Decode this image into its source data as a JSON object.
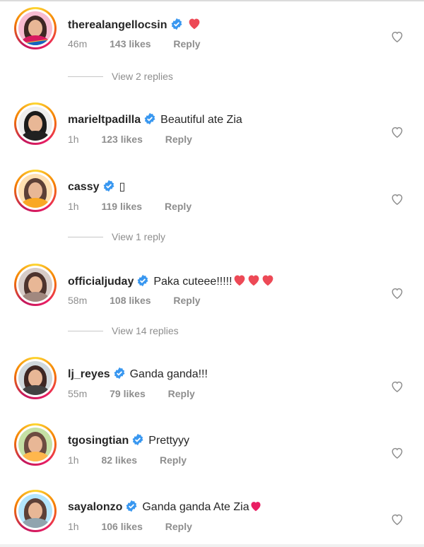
{
  "comments": [
    {
      "username": "therealangellocsin",
      "text": "",
      "emoji": "red-heart",
      "time": "46m",
      "likes": "143 likes",
      "reply": "Reply",
      "avatar_hair": "#3e2723",
      "avatar_body": "#d81b60",
      "has_logo": true
    },
    {
      "username": "marieltpadilla",
      "text": "Beautiful ate Zia",
      "emoji": "",
      "time": "1h",
      "likes": "123 likes",
      "reply": "Reply",
      "avatar_hair": "#1b1b1b",
      "avatar_body": "#212121"
    },
    {
      "username": "cassy",
      "text": "▯",
      "emoji": "",
      "time": "1h",
      "likes": "119 likes",
      "reply": "Reply",
      "avatar_hair": "#5d4037",
      "avatar_body": "#f9a825"
    },
    {
      "username": "officialjuday",
      "text": "Paka cuteee!!!!!",
      "emoji": "red-heart-x3",
      "time": "58m",
      "likes": "108 likes",
      "reply": "Reply",
      "avatar_hair": "#4e342e",
      "avatar_body": "#a1887f"
    },
    {
      "username": "lj_reyes",
      "text": "Ganda ganda!!!",
      "emoji": "",
      "time": "55m",
      "likes": "79 likes",
      "reply": "Reply",
      "avatar_hair": "#3e2723",
      "avatar_body": "#424242"
    },
    {
      "username": "tgosingtian",
      "text": "Prettyyy",
      "emoji": "",
      "time": "1h",
      "likes": "82 likes",
      "reply": "Reply",
      "avatar_hair": "#6d4c41",
      "avatar_body": "#ffb74d"
    },
    {
      "username": "sayalonzo",
      "text": "Ganda ganda Ate Zia",
      "emoji": "pink-heart",
      "time": "1h",
      "likes": "106 likes",
      "reply": "Reply",
      "avatar_hair": "#5d4037",
      "avatar_body": "#90a4ae"
    }
  ],
  "view_replies": [
    {
      "label": "View 2 replies"
    },
    {
      "label": "View 1 reply"
    },
    {
      "label": "View 14 replies"
    }
  ],
  "colors": {
    "verified": "#3897f0",
    "heart_red": "#ed4956",
    "heart_pink": "#e91e63",
    "muted": "#8e8e8e"
  },
  "icons": {
    "verified": "verified-badge-icon",
    "like": "heart-outline-icon"
  }
}
